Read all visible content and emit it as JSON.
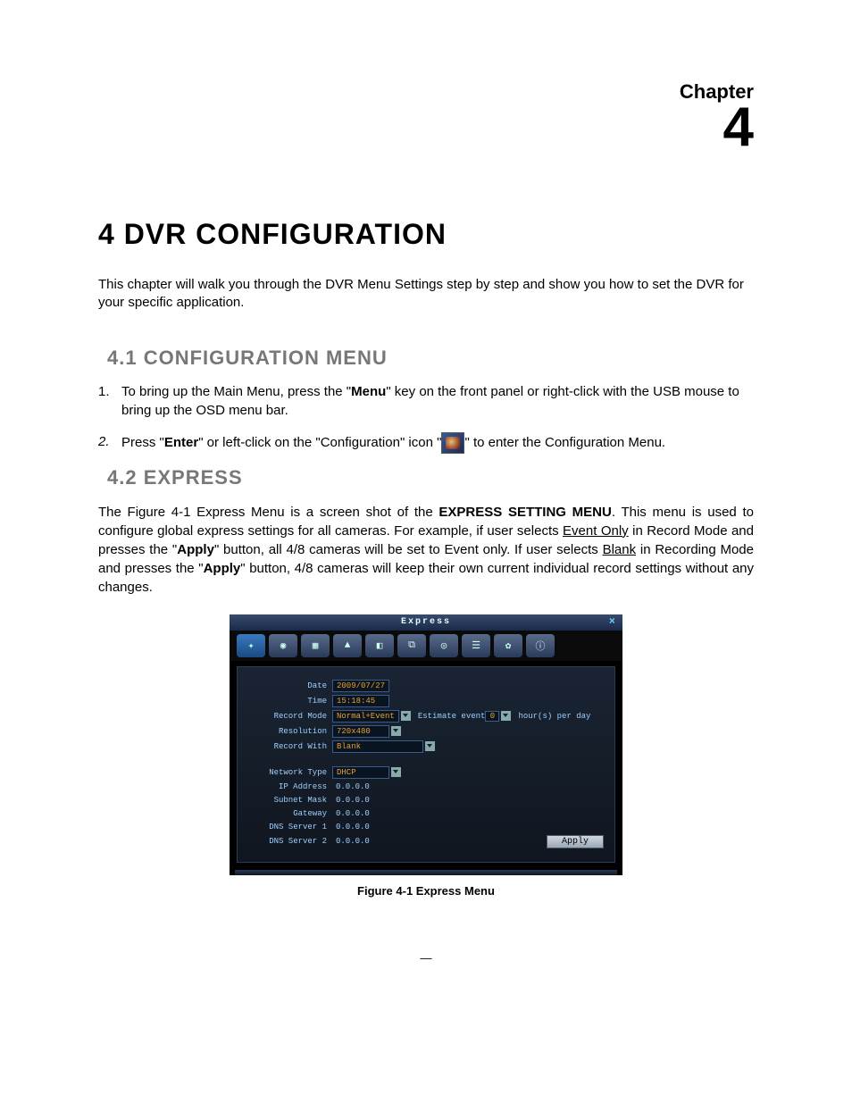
{
  "chapter": {
    "label": "Chapter",
    "num": "4"
  },
  "h1": "4  DVR CONFIGURATION",
  "intro": "This chapter will walk you through the DVR Menu Settings step by step and show you how to set the DVR for your specific application.",
  "sec1": {
    "title": "4.1  CONFIGURATION MENU",
    "items": [
      {
        "num": "1.",
        "pre": "To bring up the Main Menu, press the \"",
        "b1": "Menu",
        "post": "\" key on the front panel or right-click with the USB mouse to bring up the OSD menu bar."
      },
      {
        "num": "2.",
        "pre": "Press \"",
        "b1": "Enter",
        "mid": "\" or left-click on the \"Configuration\" icon \"",
        "post": "\" to enter the Configuration Menu."
      }
    ]
  },
  "sec2": {
    "title": "4.2  EXPRESS",
    "p_a": "The Figure 4-1 Express Menu is a screen shot of the ",
    "p_b": "EXPRESS SETTING MENU",
    "p_c": ". This menu is used to configure global express settings for all cameras. For example, if user selects ",
    "u1": "Event Only",
    "p_d": " in Record Mode and presses the \"",
    "b1": "Apply",
    "p_e": "\" button, all 4/8 cameras will be set to Event only. If user selects ",
    "u2": "Blank",
    "p_f": " in Recording Mode and presses the \"",
    "b2": "Apply",
    "p_g": "\" button, 4/8 cameras will keep their own current individual record settings without any changes."
  },
  "shot": {
    "title": "Express",
    "icons": [
      "tools",
      "cam",
      "grid",
      "bell",
      "disk",
      "net",
      "display",
      "list",
      "gear",
      "info"
    ],
    "rows": {
      "date_l": "Date",
      "date_v": "2009/07/27",
      "time_l": "Time",
      "time_v": "15:18:45",
      "recmode_l": "Record Mode",
      "recmode_v": "Normal+Event",
      "est_pre": "Estimate event",
      "est_v": "0",
      "est_post": "hour(s) per day",
      "res_l": "Resolution",
      "res_v": "720x480",
      "recwith_l": "Record With",
      "recwith_v": "Blank",
      "nett_l": "Network Type",
      "nett_v": "DHCP",
      "ip_l": "IP Address",
      "ip_v": "0.0.0.0",
      "sub_l": "Subnet Mask",
      "sub_v": "0.0.0.0",
      "gw_l": "Gateway",
      "gw_v": "0.0.0.0",
      "dns1_l": "DNS Server 1",
      "dns1_v": "0.0.0.0",
      "dns2_l": "DNS Server 2",
      "dns2_v": "0.0.0.0",
      "apply": "Apply"
    }
  },
  "caption": "Figure 4-1 Express Menu"
}
